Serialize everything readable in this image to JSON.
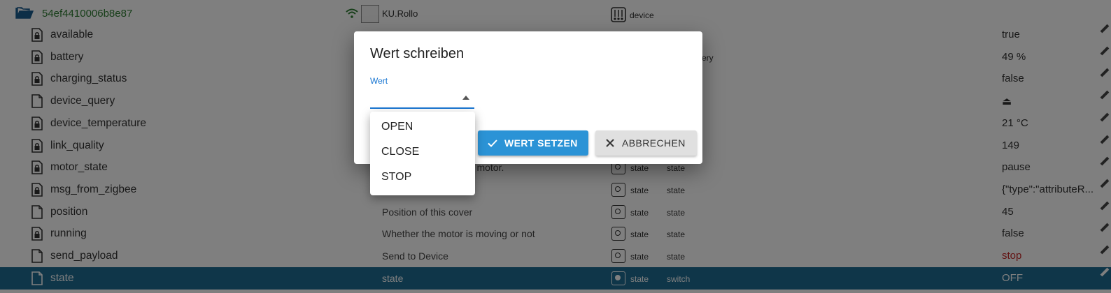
{
  "device": {
    "name": "54ef4410006b8e87",
    "common_name": "KU.Rollo",
    "type": "device"
  },
  "rows": [
    {
      "name": "available",
      "desc": "",
      "type": "",
      "role": "",
      "value": "true",
      "readonly": true
    },
    {
      "name": "battery",
      "desc": "",
      "type": "",
      "role": "ery",
      "value": "49 %",
      "readonly": true
    },
    {
      "name": "charging_status",
      "desc": "",
      "type": "",
      "role": "",
      "value": "false",
      "readonly": true
    },
    {
      "name": "device_query",
      "desc": "",
      "type": "",
      "role": "",
      "value": "⏏",
      "readonly": false
    },
    {
      "name": "device_temperature",
      "desc": "",
      "type": "",
      "role": "",
      "value": "21 °C",
      "readonly": true
    },
    {
      "name": "link_quality",
      "desc": "",
      "type": "",
      "role": "",
      "value": "149",
      "readonly": true
    },
    {
      "name": "motor_state",
      "desc": "he motor.",
      "type": "state",
      "role": "state",
      "value": "pause",
      "readonly": true
    },
    {
      "name": "msg_from_zigbee",
      "desc": "",
      "type": "state",
      "role": "state",
      "value": "{\"type\":\"attributeR...",
      "readonly": true
    },
    {
      "name": "position",
      "desc": "Position of this cover",
      "type": "state",
      "role": "state",
      "value": "45",
      "readonly": false
    },
    {
      "name": "running",
      "desc": "Whether the motor is moving or not",
      "type": "state",
      "role": "state",
      "value": "false",
      "readonly": true
    },
    {
      "name": "send_payload",
      "desc": "Send to Device",
      "type": "state",
      "role": "state",
      "value": "stop",
      "readonly": false
    },
    {
      "name": "state",
      "desc": "state",
      "type": "state",
      "role": "switch",
      "value": "OFF",
      "readonly": false
    }
  ],
  "colors": {
    "selected_row": "#1f6d93",
    "primary": "#2b93d6",
    "device_name": "#2e7d32",
    "error_value": "#c62828"
  },
  "dialog": {
    "title": "Wert schreiben",
    "field_label": "Wert",
    "set_button": "WERT SETZEN",
    "cancel_button": "ABBRECHEN",
    "options": [
      "OPEN",
      "CLOSE",
      "STOP"
    ]
  }
}
